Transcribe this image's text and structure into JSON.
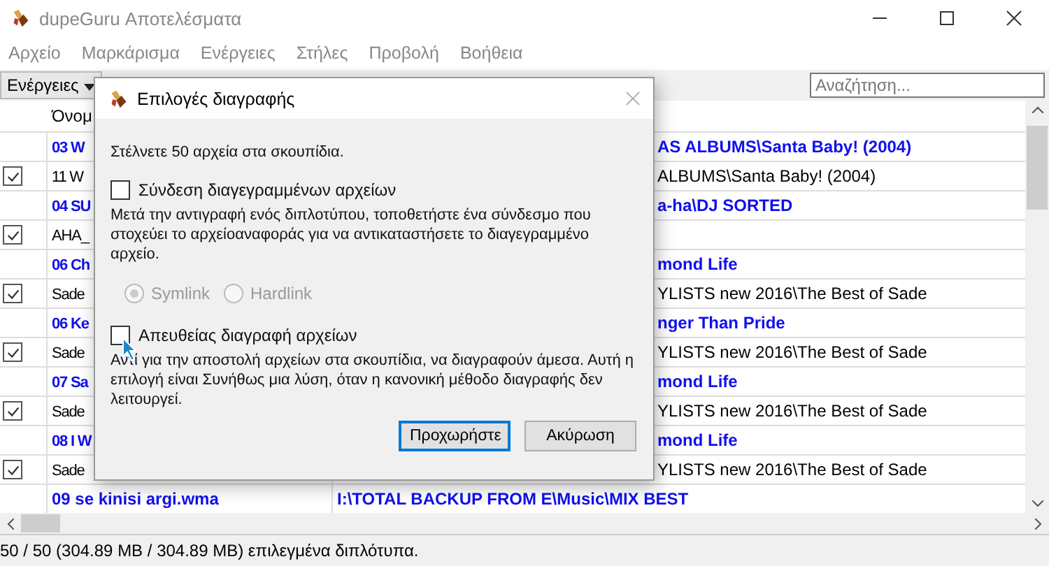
{
  "window": {
    "title": "dupeGuru Αποτελέσματα"
  },
  "menu": [
    "Αρχείο",
    "Μαρκάρισμα",
    "Ενέργειες",
    "Στήλες",
    "Προβολή",
    "Βοήθεια"
  ],
  "toolbar": {
    "actions_button": "Ενέργειες",
    "search": {
      "placeholder": "Αναζήτηση..."
    }
  },
  "table": {
    "columns": [
      "Όνομ"
    ],
    "rows": [
      {
        "kind": "reference",
        "name": "03 W",
        "folder": "AS ALBUMS\\Santa Baby! (2004)"
      },
      {
        "kind": "duplicate",
        "checked": true,
        "name": "11 W",
        "folder": "ALBUMS\\Santa Baby! (2004)"
      },
      {
        "kind": "reference",
        "name": "04 SU",
        "folder": "a-ha\\DJ SORTED"
      },
      {
        "kind": "duplicate",
        "checked": true,
        "name": "AHA_"
      },
      {
        "kind": "reference",
        "name": "06 Ch",
        "folder": "mond Life"
      },
      {
        "kind": "duplicate",
        "checked": true,
        "name": "Sade",
        "folder": "YLISTS new 2016\\The Best of Sade"
      },
      {
        "kind": "reference",
        "name": "06 Ke",
        "folder": "nger Than Pride"
      },
      {
        "kind": "duplicate",
        "checked": true,
        "name": "Sade",
        "folder": "YLISTS new 2016\\The Best of Sade"
      },
      {
        "kind": "reference",
        "name": "07 Sa",
        "folder": "mond Life"
      },
      {
        "kind": "duplicate",
        "checked": true,
        "name": "Sade",
        "folder": "YLISTS new 2016\\The Best of Sade"
      },
      {
        "kind": "reference",
        "name": "08 I W",
        "folder": "mond Life"
      },
      {
        "kind": "duplicate",
        "checked": true,
        "name": "Sade",
        "folder": "YLISTS new 2016\\The Best of Sade"
      },
      {
        "kind": "reference",
        "name": "09 se kinisi argi.wma",
        "folder": "I:\\TOTAL BACKUP FROM E\\Music\\MIX BEST"
      }
    ]
  },
  "status_bar": "50 / 50 (304.89 MB / 304.89 MB) επιλεγμένα διπλότυπα.",
  "dialog": {
    "title": "Επιλογές διαγραφής",
    "message": "Στέλνετε 50 αρχεία στα σκουπίδια.",
    "link_option": {
      "label": "Σύνδεση διαγεγραμμένων αρχείων",
      "checked": false
    },
    "link_description": "Μετά την αντιγραφή ενός διπλοτύπου, τοποθετήστε ένα σύνδεσμο που στοχεύει το αρχείοαναφοράς για να αντικαταστήσετε το διαγεγραμμένο αρχείο.",
    "link_types": [
      {
        "label": "Symlink",
        "selected": true,
        "disabled": true
      },
      {
        "label": "Hardlink",
        "selected": false,
        "disabled": true
      }
    ],
    "direct_option": {
      "label": "Απευθείας διαγραφή αρχείων",
      "checked": false
    },
    "direct_description": "Αντί για την αποστολή αρχείων στα σκουπίδια, να διαγραφούν άμεσα. Αυτή η επιλογή είναι Συνήθως μια λύση, όταν η κανονική μέθοδο διαγραφής δεν λειτουργεί.",
    "buttons": [
      {
        "label": "Προχωρήστε",
        "focused": true
      },
      {
        "label": "Ακύρωση",
        "focused": false
      }
    ]
  }
}
